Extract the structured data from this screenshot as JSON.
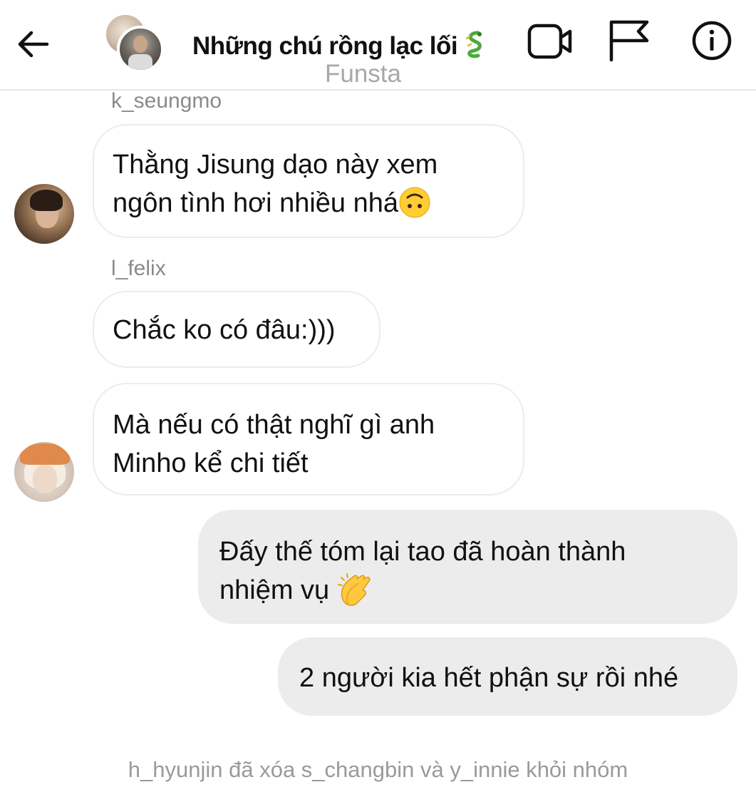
{
  "header": {
    "title": "Những chú rồng lạc lối",
    "title_emoji": "🐉",
    "subtitle": "Funsta",
    "icons": [
      "back-arrow-icon",
      "video-call-icon",
      "flag-icon",
      "info-icon"
    ]
  },
  "messages": [
    {
      "sender": "k_seungmo",
      "direction": "incoming",
      "lines": [
        "Thằng Jisung dạo này xem",
        "ngôn tình hơi nhiều nhá"
      ],
      "emoji": "upside-down-face"
    },
    {
      "sender": "l_felix",
      "direction": "incoming",
      "lines": [
        "Chắc ko có đâu:)))"
      ]
    },
    {
      "sender": "",
      "direction": "incoming",
      "lines": [
        "Mà nếu có thật nghĩ gì anh",
        "Minho kể chi tiết"
      ]
    },
    {
      "sender": "",
      "direction": "outgoing",
      "lines": [
        "Đấy thế tóm lại tao đã hoàn thành",
        "nhiệm vụ"
      ],
      "emoji": "clapping-hands"
    },
    {
      "sender": "",
      "direction": "outgoing",
      "lines": [
        "2 người kia hết phận sự rồi nhé"
      ]
    }
  ],
  "system_message": "h_hyunjin đã xóa s_changbin và y_innie khỏi nhóm",
  "colors": {
    "incoming_bubble_bg": "#ffffff",
    "incoming_bubble_border": "#ececec",
    "outgoing_bubble_bg": "#ececec",
    "meta_text": "#8a8a8a",
    "subtitle_text": "#a8a8a8"
  }
}
